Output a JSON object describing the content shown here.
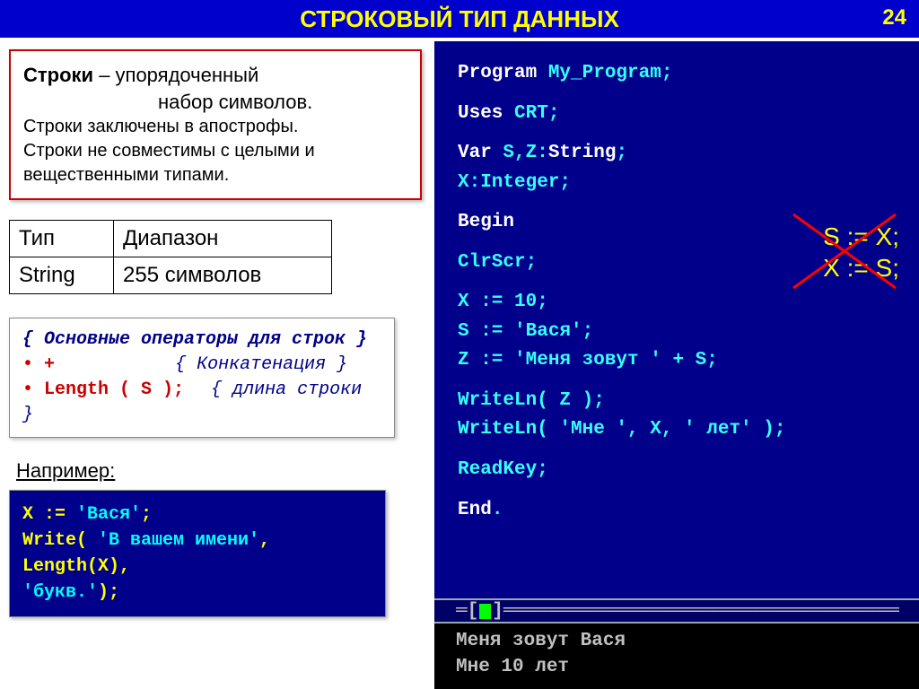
{
  "header": {
    "title": "СТРОКОВЫЙ ТИП ДАННЫХ",
    "page": "24"
  },
  "definition": {
    "term": "Строки",
    "dash": " – упорядоченный",
    "line2": "набор символов.",
    "note1": "Строки заключены в апострофы.",
    "note2": "Строки не совместимы с целыми и вещественными типами."
  },
  "table": {
    "h1": "Тип",
    "h2": "Диапазон",
    "r1c1": "String",
    "r1c2": "255 символов"
  },
  "ops": {
    "title": "{ Основные операторы для строк }",
    "concat_op": "+",
    "concat_comment": "{ Конкатенация }",
    "length_op": "Length ( S );",
    "length_comment": "{ длина строки }"
  },
  "example_label": "Например:",
  "example": {
    "l1a": "X := ",
    "l1b": "'Вася'",
    "l1c": ";",
    "l2a": "Write( ",
    "l2b": "'В вашем имени'",
    "l2c": ",",
    "l3a": "        Length(X),",
    "l4a": "        ",
    "l4b": "'букв.'",
    "l4c": ");"
  },
  "code": {
    "l1a": "Program",
    "l1b": " My_Program;",
    "l2a": "Uses",
    "l2b": " CRT;",
    "l3a": "Var",
    "l3b": " S,Z:",
    "l3c": "String",
    "l3d": ";",
    "l4": "    X:Integer;",
    "l5": "Begin",
    "l6": "  ClrScr;",
    "l7": "  X := 10;",
    "l8": "  S := 'Вася';",
    "l9": "  Z := 'Меня зовут ' + S;",
    "l10": "  WriteLn( Z );",
    "l11": "  WriteLn( 'Мне ', X, ' лет' );",
    "l12": "  ReadKey;",
    "l13a": "End",
    "l13b": "."
  },
  "wrong": {
    "l1": "S := X;",
    "l2": "X := S;"
  },
  "output": {
    "l1": "Меня зовут Вася",
    "l2": "Мне 10 лет"
  }
}
